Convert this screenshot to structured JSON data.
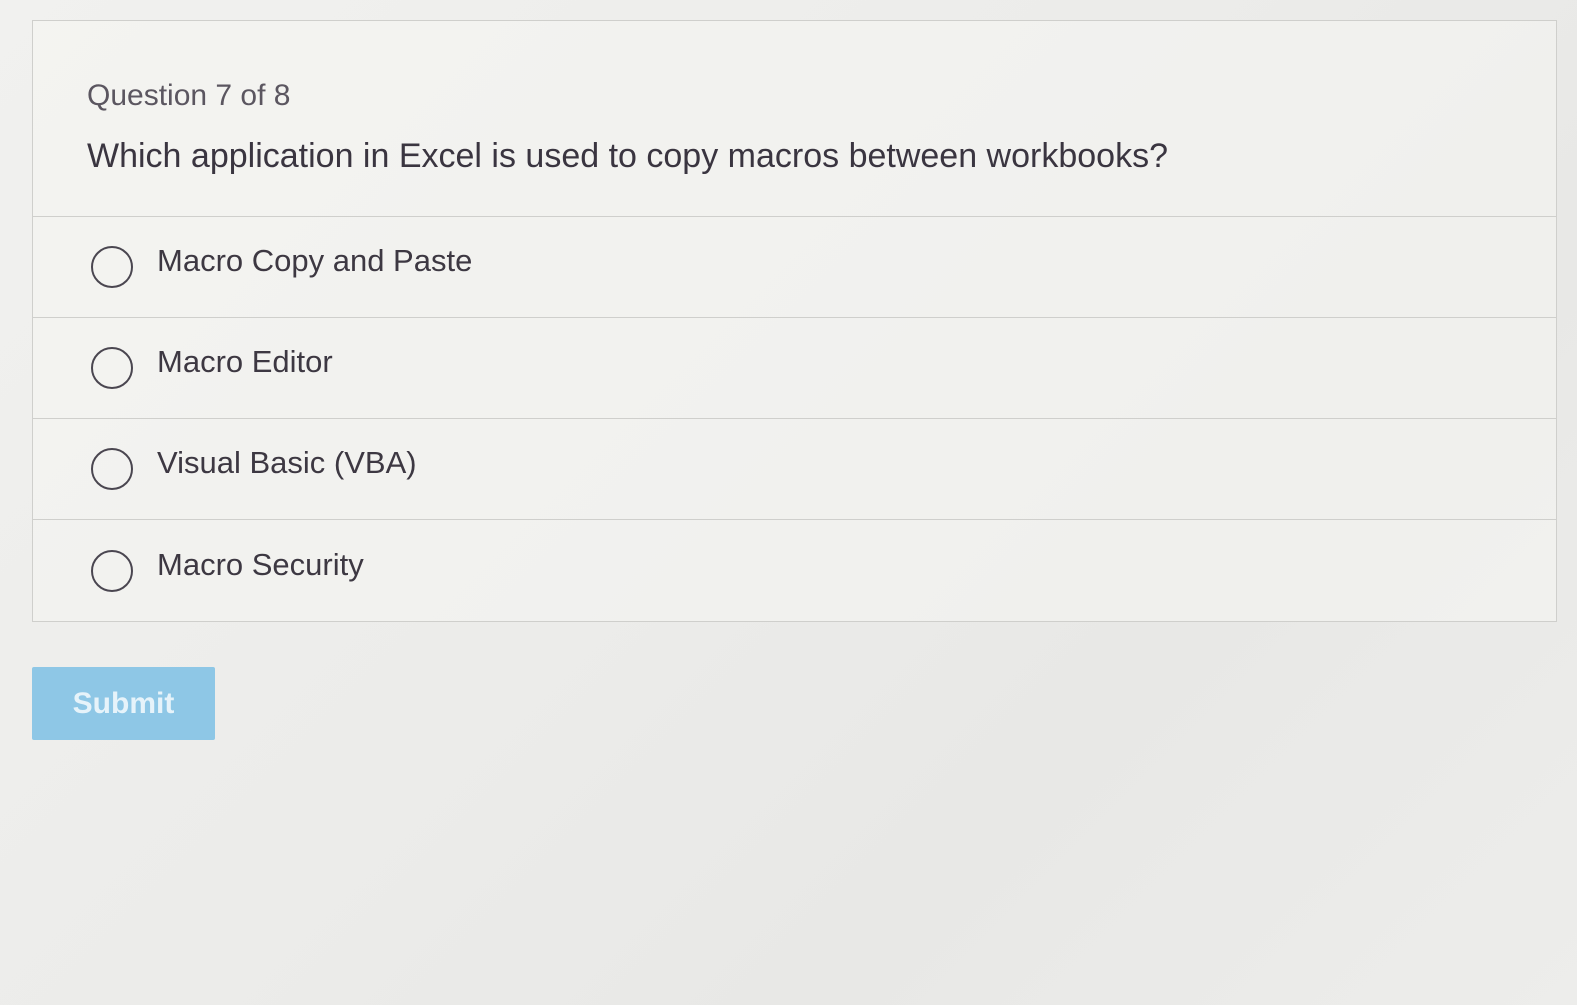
{
  "question": {
    "counter": "Question 7 of 8",
    "text": "Which application in Excel is used to copy macros between workbooks?"
  },
  "options": [
    {
      "label": "Macro Copy and Paste",
      "selected": false
    },
    {
      "label": "Macro Editor",
      "selected": false
    },
    {
      "label": "Visual Basic (VBA)",
      "selected": false
    },
    {
      "label": "Macro Security",
      "selected": false
    }
  ],
  "submit": {
    "label": "Submit",
    "enabled": false,
    "color": "#8ec7e6"
  }
}
